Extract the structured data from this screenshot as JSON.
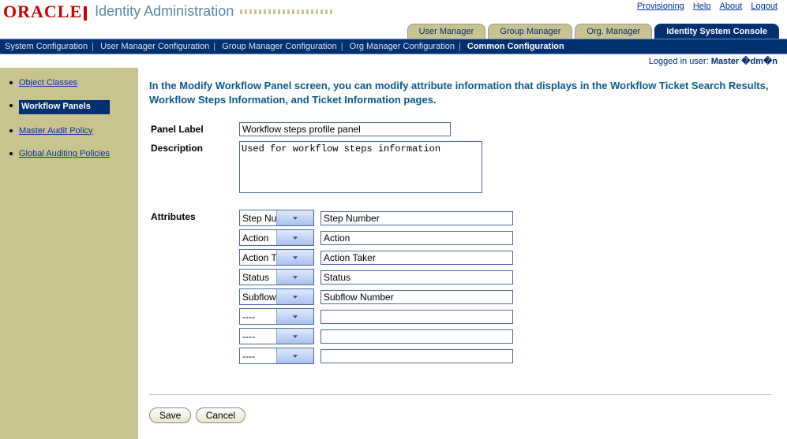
{
  "logo_text": "ORACLE",
  "app_title": "Identity Administration",
  "top_links": {
    "provisioning": "Provisioning",
    "help": "Help",
    "about": "About",
    "logout": "Logout"
  },
  "tabs": {
    "user": "User Manager",
    "group": "Group Manager",
    "org": "Org. Manager",
    "console": "Identity System Console"
  },
  "subnav": {
    "system": "System Configuration",
    "user": "User Manager Configuration",
    "group": "Group Manager Configuration",
    "org": "Org Manager Configuration",
    "common": "Common Configuration"
  },
  "status": {
    "label": "Logged in user: ",
    "user": "Master �dm�n"
  },
  "sidebar": {
    "items": [
      {
        "label": "Object Classes"
      },
      {
        "label": "Workflow Panels"
      },
      {
        "label": "Master Audit Policy"
      },
      {
        "label": "Global Auditing Policies"
      }
    ]
  },
  "intro": "In the Modify Workflow Panel screen, you can modify attribute information that displays in the Workflow Ticket Search Results, Workflow Steps Information, and Ticket Information pages.",
  "form": {
    "panel_label_lbl": "Panel Label",
    "panel_label_val": "Workflow steps profile panel",
    "description_lbl": "Description",
    "description_val": "Used for workflow steps information",
    "attributes_lbl": "Attributes",
    "rows": [
      {
        "select": "Step Number",
        "text": "Step Number"
      },
      {
        "select": "Action",
        "text": "Action"
      },
      {
        "select": "Action Taker",
        "text": "Action Taker"
      },
      {
        "select": "Status",
        "text": "Status"
      },
      {
        "select": "Subflow Number",
        "text": "Subflow Number"
      },
      {
        "select": "----",
        "text": ""
      },
      {
        "select": "----",
        "text": ""
      },
      {
        "select": "----",
        "text": ""
      }
    ]
  },
  "buttons": {
    "save": "Save",
    "cancel": "Cancel"
  }
}
